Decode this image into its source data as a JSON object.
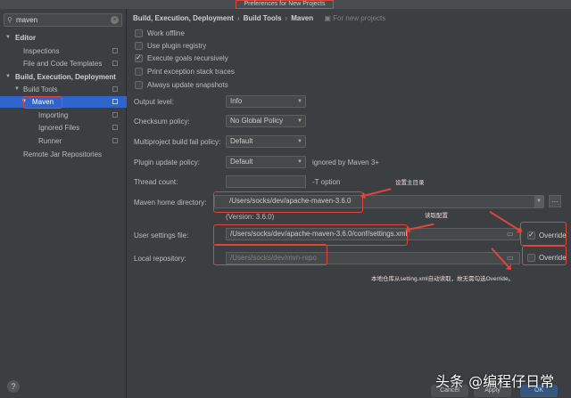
{
  "window": {
    "title": "Preferences for New Projects"
  },
  "sidebar": {
    "search_value": "maven",
    "items": [
      {
        "label": "Editor"
      },
      {
        "label": "Inspections"
      },
      {
        "label": "File and Code Templates"
      },
      {
        "label": "Build, Execution, Deployment"
      },
      {
        "label": "Build Tools"
      },
      {
        "label": "Maven"
      },
      {
        "label": "Importing"
      },
      {
        "label": "Ignored Files"
      },
      {
        "label": "Runner"
      },
      {
        "label": "Remote Jar Repositories"
      }
    ],
    "help_label": "?"
  },
  "breadcrumb": {
    "parts": [
      "Build, Execution, Deployment",
      "Build Tools",
      "Maven"
    ],
    "note": "For new projects"
  },
  "options": [
    {
      "label": "Work offline",
      "checked": false
    },
    {
      "label": "Use plugin registry",
      "checked": false
    },
    {
      "label": "Execute goals recursively",
      "checked": true
    },
    {
      "label": "Print exception stack traces",
      "checked": false
    },
    {
      "label": "Always update snapshots",
      "checked": false
    }
  ],
  "form": {
    "output_level": {
      "label": "Output level:",
      "value": "Info"
    },
    "checksum_policy": {
      "label": "Checksum policy:",
      "value": "No Global Policy"
    },
    "multiproject": {
      "label": "Multiproject build fail policy:",
      "value": "Default"
    },
    "plugin_update": {
      "label": "Plugin update policy:",
      "value": "Default",
      "hint": "ignored by Maven 3+"
    },
    "thread_count": {
      "label": "Thread count:",
      "value": "",
      "hint": "-T option"
    },
    "maven_home": {
      "label": "Maven home directory:",
      "value": "/Users/socks/dev/apache-maven-3.6.0",
      "version": "(Version: 3.6.0)",
      "browse": "..."
    },
    "user_settings": {
      "label": "User settings file:",
      "value": "/Users/socks/dev/apache-maven-3.6.0/conf/settings.xml",
      "override_label": "Override",
      "override_checked": true
    },
    "local_repo": {
      "label": "Local repository:",
      "value": "/Users/socks/dev/mvn-repo",
      "override_label": "Override",
      "override_checked": false
    }
  },
  "annotations": {
    "home": "设置主目录",
    "settings": "读取配置",
    "repo": "本地仓库从setting.xml自动读取，故无需勾选Override。"
  },
  "footer": {
    "cancel": "Cancel",
    "apply": "Apply",
    "ok": "OK"
  },
  "watermark": "头条 @编程仔日常",
  "colors": {
    "background": "#3c3f41",
    "selection": "#2f65ca",
    "annotation": "#e0453b"
  }
}
